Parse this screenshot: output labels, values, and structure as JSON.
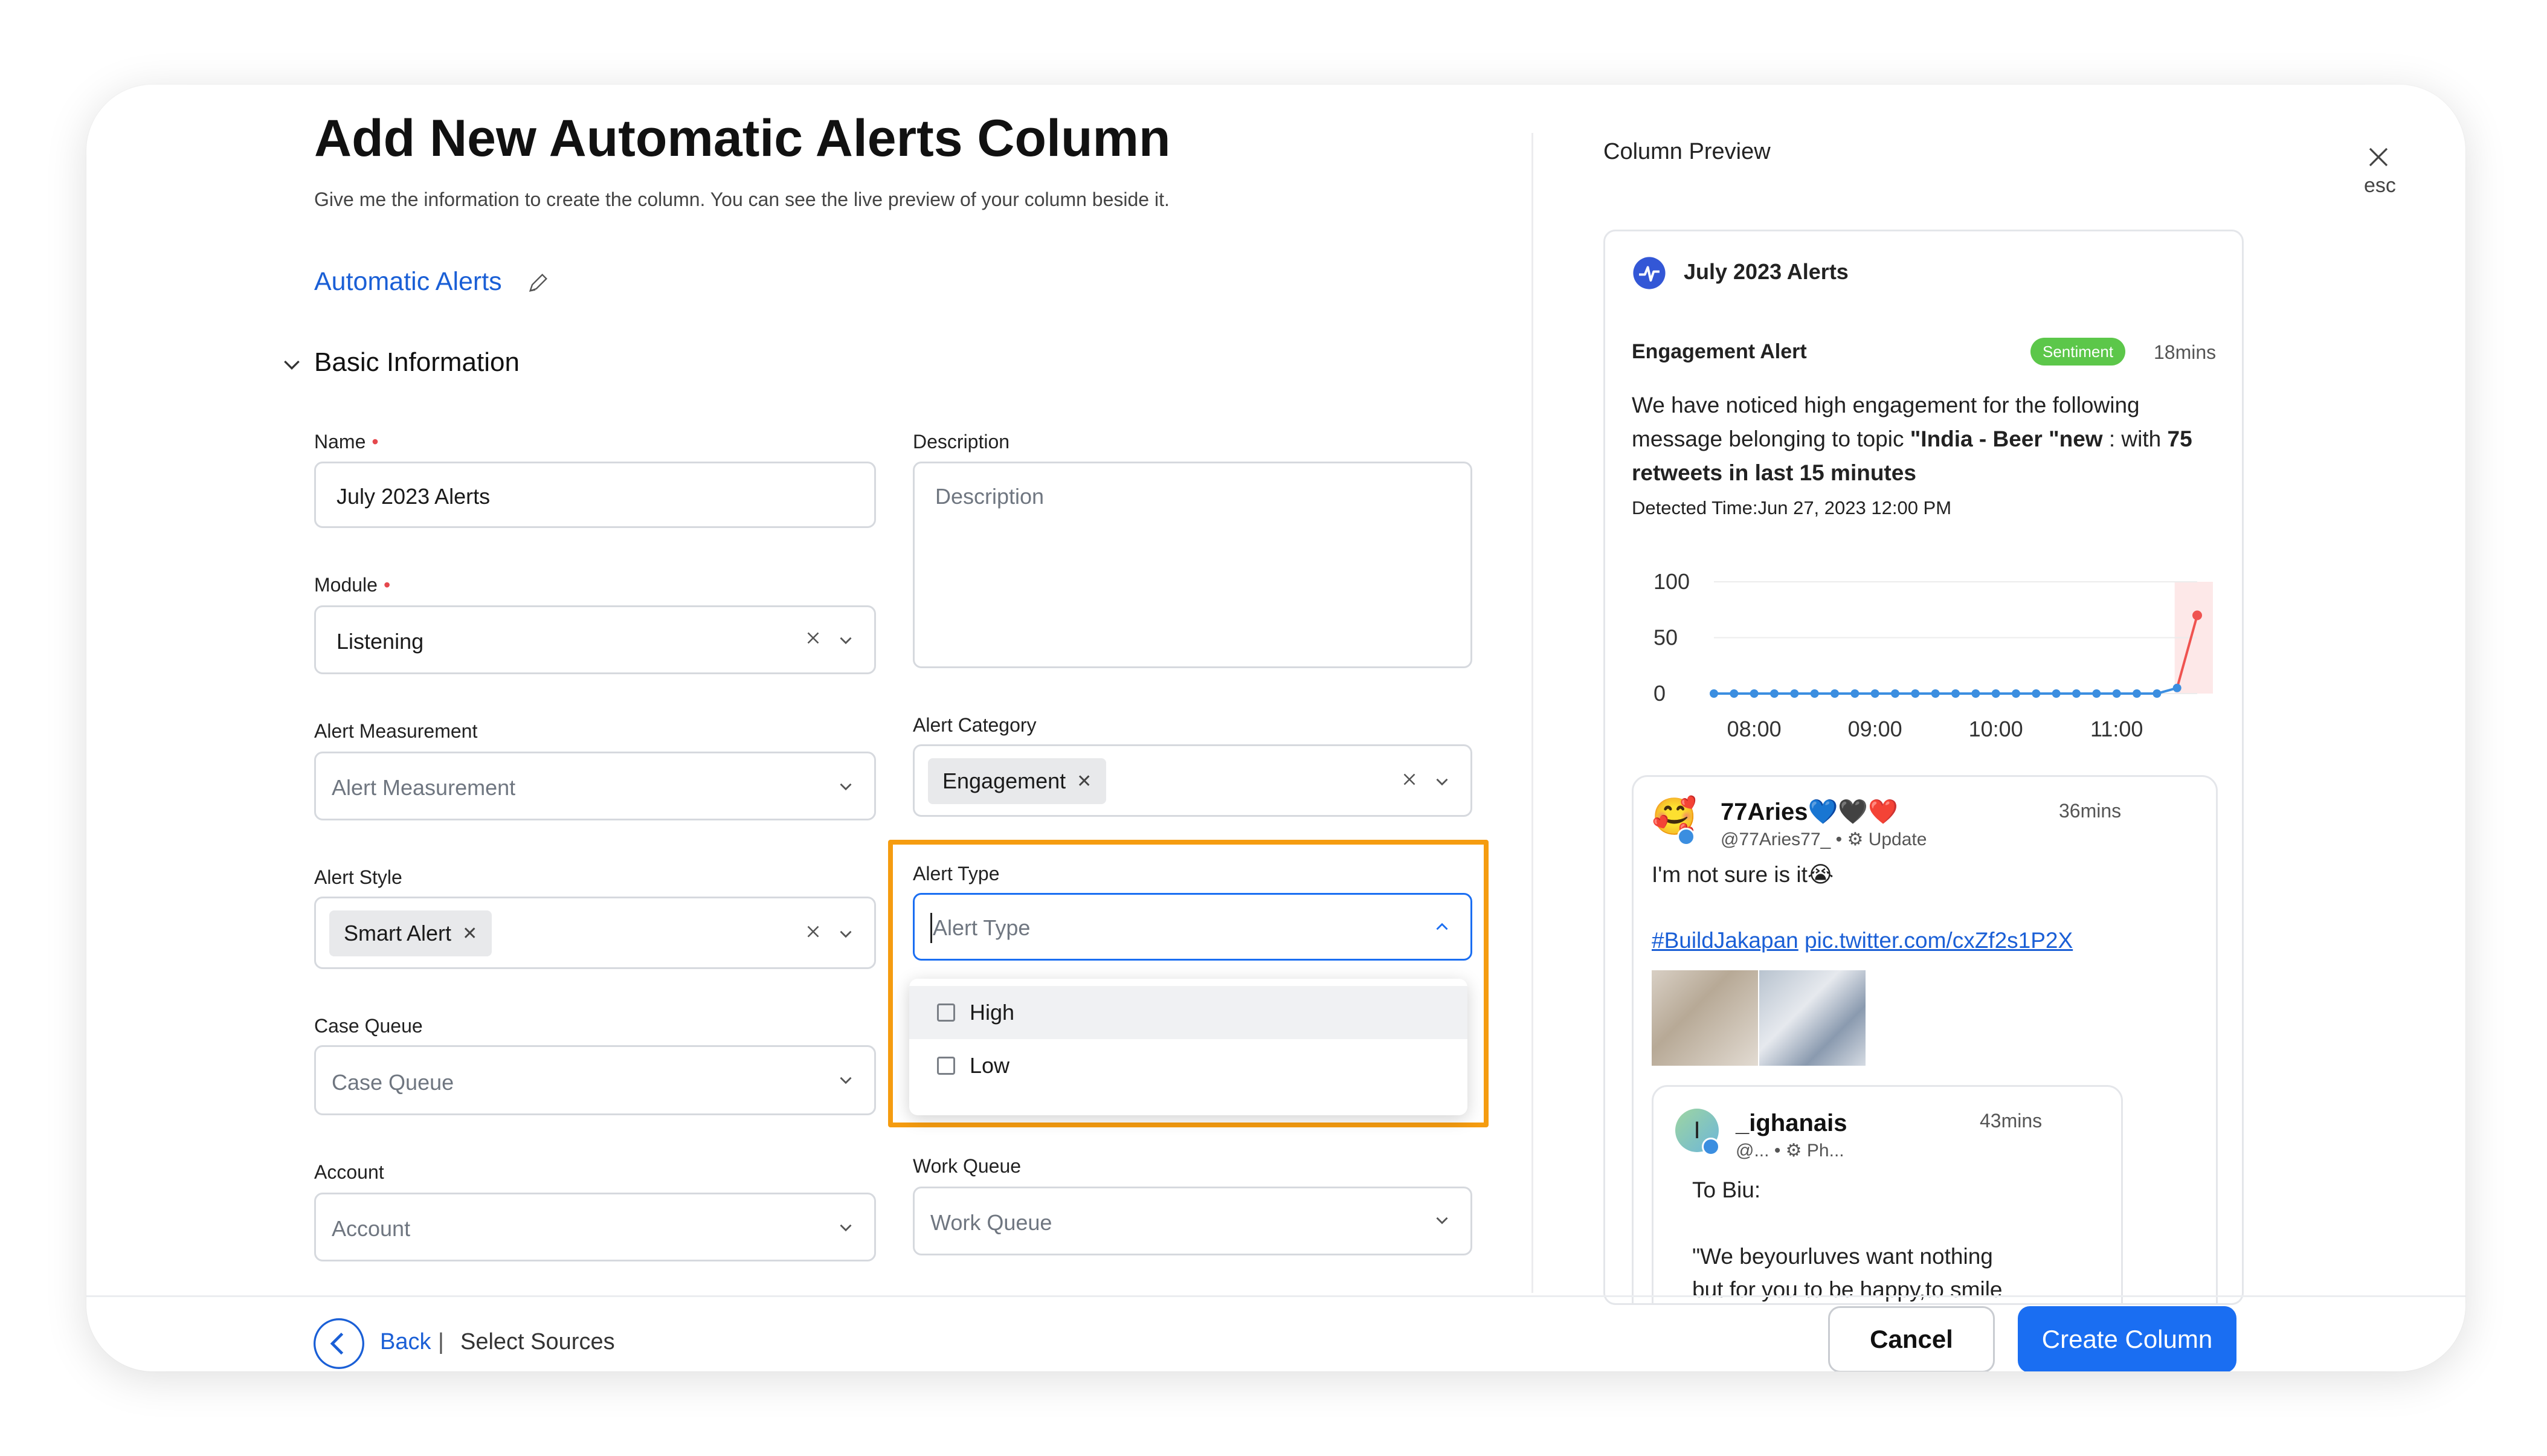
{
  "header": {
    "title": "Add New Automatic Alerts Column",
    "subtitle": "Give me the information to create the column. You can see the live preview of your column beside it.",
    "column_name": "Automatic Alerts"
  },
  "section": {
    "title": "Basic Information"
  },
  "form": {
    "name": {
      "label": "Name",
      "value": "July 2023 Alerts"
    },
    "description": {
      "label": "Description",
      "placeholder": "Description"
    },
    "module": {
      "label": "Module",
      "value": "Listening"
    },
    "alert_measurement": {
      "label": "Alert Measurement",
      "placeholder": "Alert Measurement"
    },
    "alert_category": {
      "label": "Alert Category",
      "chip": "Engagement"
    },
    "alert_style": {
      "label": "Alert Style",
      "chip": "Smart Alert"
    },
    "alert_type": {
      "label": "Alert Type",
      "placeholder": "Alert Type",
      "options": [
        "High",
        "Low"
      ]
    },
    "case_queue": {
      "label": "Case Queue",
      "placeholder": "Case Queue"
    },
    "account": {
      "label": "Account",
      "placeholder": "Account"
    },
    "work_queue": {
      "label": "Work Queue",
      "placeholder": "Work Queue"
    },
    "required_mark": "•"
  },
  "preview": {
    "heading": "Column Preview",
    "close_label": "esc",
    "card_title": "July 2023 Alerts",
    "alert": {
      "title": "Engagement Alert",
      "badge": "Sentiment",
      "time": "18mins",
      "text_1": "We have noticed high engagement for the following message belonging to topic ",
      "topic": "\"India - Beer \"new",
      "text_2": " : with ",
      "text_3": "75 retweets in last 15 minutes",
      "detected": "Detected Time:Jun 27, 2023 12:00 PM"
    },
    "chart_data": {
      "type": "line",
      "x": [
        "07:40",
        "07:50",
        "08:00",
        "08:10",
        "08:20",
        "08:30",
        "08:40",
        "08:50",
        "09:00",
        "09:10",
        "09:20",
        "09:30",
        "09:40",
        "09:50",
        "10:00",
        "10:10",
        "10:20",
        "10:30",
        "10:40",
        "10:50",
        "11:00",
        "11:10",
        "11:20",
        "11:30",
        "11:40"
      ],
      "values": [
        0,
        0,
        0,
        0,
        0,
        0,
        0,
        0,
        0,
        0,
        0,
        0,
        0,
        0,
        0,
        0,
        0,
        0,
        0,
        0,
        0,
        0,
        0,
        5,
        70
      ],
      "xticks": [
        "08:00",
        "09:00",
        "10:00",
        "11:00"
      ],
      "yticks": [
        "100",
        "50",
        "0"
      ],
      "ylim": [
        0,
        100
      ],
      "grid": true,
      "line_color": "#3b8ee0",
      "spike_color": "#ef5350"
    },
    "tweet_1": {
      "name": "77Aries💙🖤❤️",
      "handle": "@77Aries77_",
      "dot": "•",
      "action": "Update",
      "time": "36mins",
      "text": "I'm not sure is it😭",
      "hashtag": "#BuildJakapan",
      "link": "pic.twitter.com/cxZf2s1P2X"
    },
    "tweet_2": {
      "avatar_letter": "I",
      "name": "_ighanais",
      "handle": "@...",
      "dot": "•",
      "action": "Ph...",
      "time": "43mins",
      "line_1": "To Biu:",
      "line_2": "\"We beyourluves want nothing",
      "line_3": "but for you to be happy,to smile"
    }
  },
  "footer": {
    "back": "Back",
    "separator": "|",
    "step": "Select Sources",
    "cancel": "Cancel",
    "create": "Create Column"
  },
  "colors": {
    "primary": "#1a6ef2",
    "link": "#1a5fd6",
    "highlight": "#f59c10",
    "badge": "#5cc74a",
    "required": "#e5484d"
  }
}
